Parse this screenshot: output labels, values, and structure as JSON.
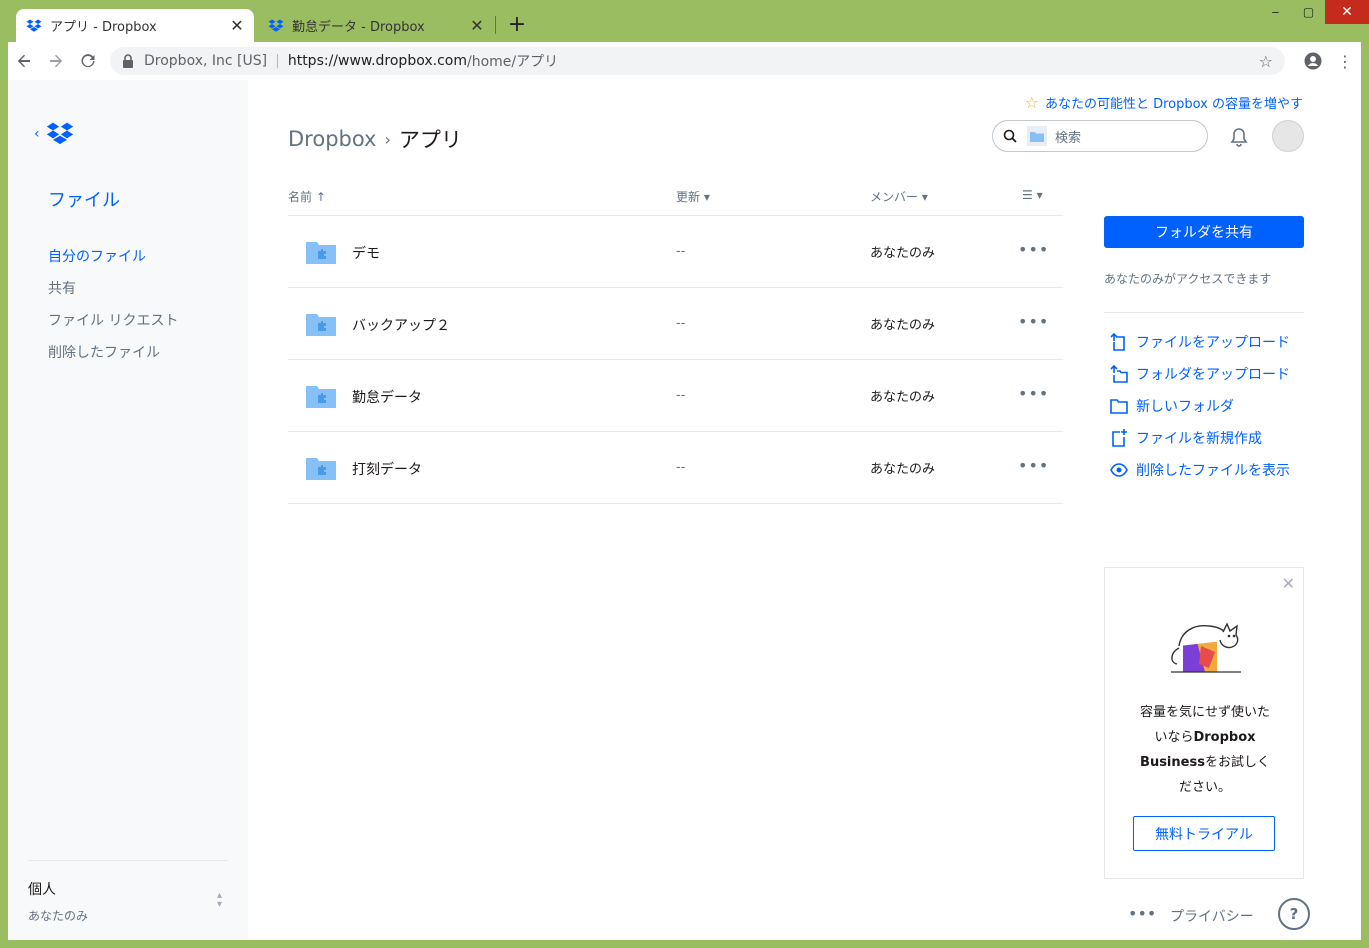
{
  "browser": {
    "tabs": [
      {
        "title": "アプリ - Dropbox",
        "close": "✕"
      },
      {
        "title": "勤怠データ - Dropbox",
        "close": "✕"
      }
    ],
    "new_tab": "+",
    "window_controls": {
      "minimize": "‒",
      "maximize": "▢",
      "close": "✕"
    },
    "address": {
      "org": "Dropbox, Inc [US]",
      "separator": "|",
      "url_host": "https://www.dropbox.com",
      "url_path": "/home/アプリ"
    },
    "colors": {
      "frame": "#9bbd62",
      "close": "#c42b1c"
    }
  },
  "sidebar": {
    "files_heading": "ファイル",
    "nav": [
      "自分のファイル",
      "共有",
      "ファイル リクエスト",
      "削除したファイル"
    ],
    "account": {
      "type": "個人",
      "name": "あなたのみ"
    }
  },
  "header": {
    "upgrade_link": "あなたの可能性と Dropbox の容量を増やす",
    "breadcrumb": [
      "Dropbox",
      "アプリ"
    ],
    "search_placeholder": "検索"
  },
  "table": {
    "columns": {
      "name": "名前",
      "modified": "更新",
      "members": "メンバー"
    },
    "sort_up": "↑",
    "caret": "▾",
    "rows": [
      {
        "name": "デモ",
        "modified": "--",
        "members": "あなたのみ",
        "more": "•••"
      },
      {
        "name": "バックアップ２",
        "modified": "--",
        "members": "あなたのみ",
        "more": "•••"
      },
      {
        "name": "勤怠データ",
        "modified": "--",
        "members": "あなたのみ",
        "more": "•••"
      },
      {
        "name": "打刻データ",
        "modified": "--",
        "members": "あなたのみ",
        "more": "•••"
      }
    ]
  },
  "right_panel": {
    "share_button": "フォルダを共有",
    "access_note": "あなたのみがアクセスできます",
    "actions": [
      "ファイルをアップロード",
      "フォルダをアップロード",
      "新しいフォルダ",
      "ファイルを新規作成",
      "削除したファイルを表示"
    ],
    "promo": {
      "close": "✕",
      "line1": "容量を気にせず使いた",
      "line2_pre": "いなら",
      "line2_bold": "Dropbox",
      "line3_bold": "Business",
      "line3_post": "をお試しく",
      "line4": "ださい。",
      "trial_button": "無料トライアル"
    }
  },
  "footer": {
    "more": "•••",
    "privacy": "プライバシー",
    "help": "?"
  },
  "colors": {
    "accent": "#0061fe",
    "muted": "#637282",
    "folder": "#86c0f7"
  }
}
